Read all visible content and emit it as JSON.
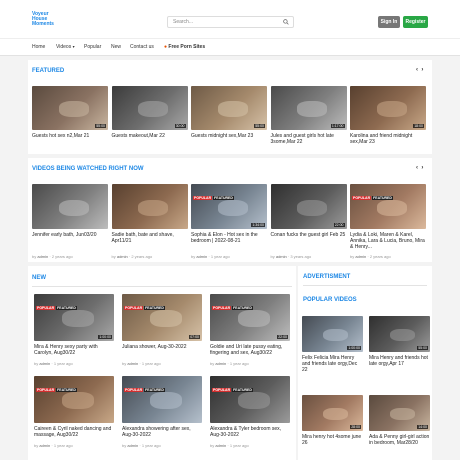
{
  "header": {
    "logo": [
      "Voyeur",
      "House",
      "Moments"
    ],
    "search_placeholder": "Search...",
    "signin": "Sign In",
    "register": "Register"
  },
  "nav": {
    "items": [
      "Home",
      "Videos",
      "Popular",
      "New",
      "Contact us"
    ],
    "free": "Free Porn Sites"
  },
  "featured": {
    "title": "FEATURED",
    "items": [
      {
        "title": "Guests hot sex n2,Mar 21",
        "dur": "55:00"
      },
      {
        "title": "Guests makeout,Mar 22",
        "dur": "30:00"
      },
      {
        "title": "Guests midnight sex,Mar 23",
        "dur": "55:00"
      },
      {
        "title": "Jules and guest girls hot late 3some,Mar 22",
        "dur": "1:17:00"
      },
      {
        "title": "Karolina and friend midnight sex,Mar 23",
        "dur": "18:00"
      }
    ]
  },
  "watched": {
    "title": "VIDEOS BEING WATCHED RIGHT NOW",
    "items": [
      {
        "title": "Jennifer early bath, Jun03/20",
        "by": "admin",
        "ago": "2 years ago",
        "dur": "",
        "badges": []
      },
      {
        "title": "Sadie bath, bate and shave, Apr11/21",
        "by": "admin",
        "ago": "2 years ago",
        "dur": "",
        "badges": []
      },
      {
        "title": "Sophia & Elon - Hot sex in the bedroom | 2022-08-21",
        "by": "admin",
        "ago": "1 year ago",
        "dur": "1:34:00",
        "badges": [
          "POPULAR",
          "FEATURED"
        ]
      },
      {
        "title": "Conan fucks the guest girl Feb 25",
        "by": "admin",
        "ago": "3 years ago",
        "dur": "22:00",
        "badges": []
      },
      {
        "title": "Lydia & Loki, Maren & Karel, Annika, Lara & Lucia, Bruno, Mira & Henry...",
        "by": "admin",
        "ago": "2 years ago",
        "dur": "",
        "badges": [
          "POPULAR",
          "FEATURED"
        ]
      }
    ]
  },
  "new": {
    "title": "NEW",
    "items": [
      {
        "title": "Mira & Henry sexy party with Carolyn, Aug30/22",
        "by": "admin",
        "ago": "1 year ago",
        "dur": "1:00:00",
        "badges": [
          "POPULAR",
          "FEATURED"
        ]
      },
      {
        "title": "Juliana shower, Aug-30-2022",
        "by": "admin",
        "ago": "1 year ago",
        "dur": "07:00",
        "badges": [
          "POPULAR",
          "FEATURED"
        ]
      },
      {
        "title": "Goldie and Uri late pussy eating, fingering and sex, Aug30/22",
        "by": "admin",
        "ago": "1 year ago",
        "dur": "22:00",
        "badges": [
          "POPULAR",
          "FEATURED"
        ]
      },
      {
        "title": "Caireen & Cyril naked dancing and massage, Aug30/22",
        "by": "admin",
        "ago": "1 year ago",
        "dur": "",
        "badges": [
          "POPULAR",
          "FEATURED"
        ]
      },
      {
        "title": "Alexandra showering after sex, Aug-30-2022",
        "by": "admin",
        "ago": "1 year ago",
        "dur": "",
        "badges": [
          "POPULAR",
          "FEATURED"
        ]
      },
      {
        "title": "Alexandra & Tyler bedroom sex, Aug-30-2022",
        "by": "admin",
        "ago": "1 year ago",
        "dur": "",
        "badges": [
          "POPULAR",
          "FEATURED"
        ]
      }
    ]
  },
  "sidebar": {
    "ad_title": "ADVERTISMENT",
    "popular_title": "POPULAR VIDEOS",
    "items": [
      {
        "title": "Felix Felicia Mira Henry and friends late orgy,Dec 22",
        "dur": "1:00:00"
      },
      {
        "title": "Mira Henry and friends hot late orgy,Apr 17",
        "dur": "55:00"
      },
      {
        "title": "Mira henry hot 4some june 26",
        "dur": "28:00"
      },
      {
        "title": "Ada & Penny girl-girl action in bedroom, Mar28/20",
        "dur": "14:00"
      }
    ]
  },
  "badge_labels": {
    "popular": "POPULAR",
    "featured": "FEATURED"
  }
}
